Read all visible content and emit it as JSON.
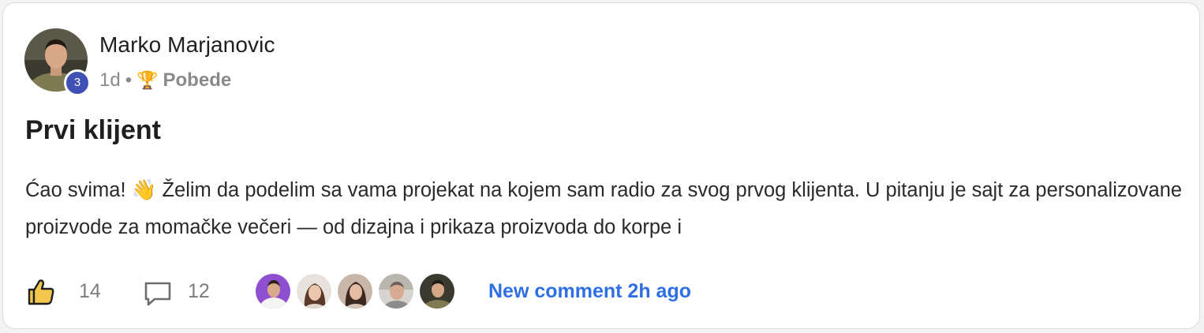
{
  "author": {
    "name": "Marko Marjanovic",
    "level": "3",
    "avatar": "user-photo"
  },
  "meta": {
    "time": "1d",
    "separator": "•",
    "category_icon": "trophy-icon",
    "category": "Pobede"
  },
  "post": {
    "title": "Prvi klijent",
    "body": "Ćao svima! 👋 Želim da podelim sa vama projekat na kojem sam radio za svog prvog klijenta. U pitanju je sajt za personalizovane proizvode za momačke večeri — od dizajna i prikaza proizvoda do korpe i"
  },
  "footer": {
    "likes": "14",
    "comments": "12",
    "like_icon": "thumbs-up-icon",
    "comment_icon": "comment-icon",
    "commenter_avatars": [
      "commenter-1",
      "commenter-2",
      "commenter-3",
      "commenter-4",
      "commenter-5"
    ],
    "new_comment_text": "New comment 2h ago"
  },
  "colors": {
    "badge": "#3f51b5",
    "link": "#2f6fe4",
    "muted": "#8a8a8a"
  }
}
